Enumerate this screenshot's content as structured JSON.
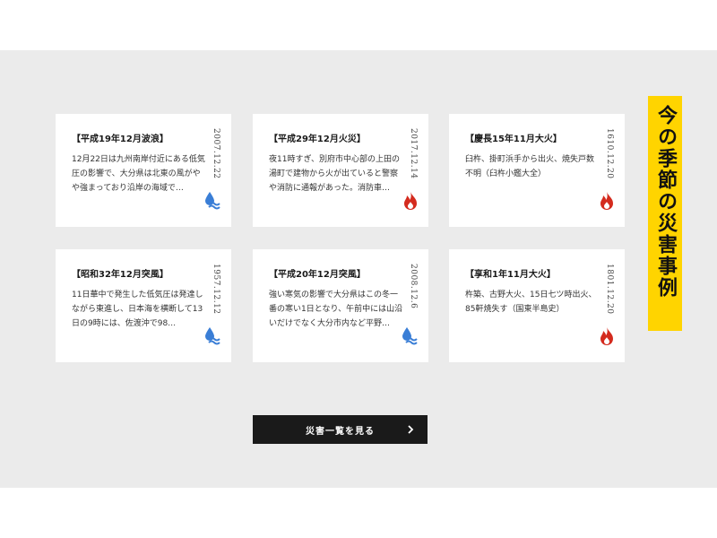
{
  "section_heading": "今の季節の災害事例",
  "cards": [
    {
      "title": "【平成19年12月波浪】",
      "date": "2007.12.22",
      "desc": "12月22日は九州南岸付近にある低気圧の影響で、大分県は北東の風がやや強まっており沿岸の海域で…",
      "icon": "wave-icon",
      "icon_color": "#3a7ed6"
    },
    {
      "title": "【平成29年12月火災】",
      "date": "2017.12.14",
      "desc": "夜11時すぎ、別府市中心部の上田の湯町で建物から火が出ていると警察や消防に通報があった。消防車…",
      "icon": "fire-icon",
      "icon_color": "#d42b1e"
    },
    {
      "title": "【慶長15年11月大火】",
      "date": "1610.12.20",
      "desc": "臼杵、掛町浜手から出火、焼失戸数不明（臼杵小鑑大全）",
      "icon": "fire-icon",
      "icon_color": "#d42b1e"
    },
    {
      "title": "【昭和32年12月突風】",
      "date": "1957.12.12",
      "desc": "11日華中で発生した低気圧は発達しながら東進し、日本海を横断して13日の9時には、佐渡沖で98…",
      "icon": "wave-icon",
      "icon_color": "#3a7ed6"
    },
    {
      "title": "【平成20年12月突風】",
      "date": "2008.12.6",
      "desc": "強い寒気の影響で大分県はこの冬一番の寒い1日となり、午前中には山沿いだけでなく大分市内など平野…",
      "icon": "wave-icon",
      "icon_color": "#3a7ed6"
    },
    {
      "title": "【享和1年11月大火】",
      "date": "1801.12.20",
      "desc": "杵築、古野大火、15日七ツ時出火、85軒焼失す（国東半島史）",
      "icon": "fire-icon",
      "icon_color": "#d42b1e"
    }
  ],
  "more_button": {
    "label": "災害一覧を見る",
    "arrow": "chevron-right-icon"
  },
  "colors": {
    "background": "#ebebeb",
    "heading_bg": "#ffd400",
    "button_bg": "#1a1a1a"
  }
}
